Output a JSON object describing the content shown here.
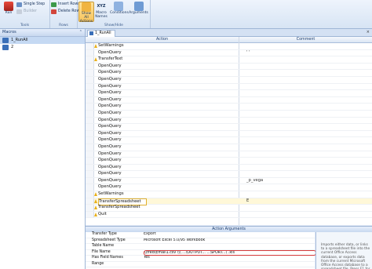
{
  "ribbon": {
    "tools": {
      "run": "Run",
      "single_step": "Single Step",
      "builder": "Builder",
      "label": "Tools"
    },
    "rows": {
      "insert": "Insert Rows",
      "delete": "Delete Rows",
      "label": "Rows"
    },
    "show_hide": {
      "show_all": "Show All Actions",
      "macro_names": "Macro Names",
      "conditions": "Conditions",
      "arguments": "Arguments",
      "xyz": "XYZ",
      "label": "Show/Hide"
    }
  },
  "nav": {
    "title": "Macros",
    "items": [
      {
        "label": "1_RunAll",
        "selected": true
      },
      {
        "label": "2",
        "selected": false
      }
    ]
  },
  "tab": {
    "label": "1_RunAll"
  },
  "grid": {
    "headers": {
      "action": "Action",
      "comment": "Comment"
    },
    "rows": [
      {
        "action": "SetWarnings",
        "comment": "",
        "warn": true
      },
      {
        "action": "OpenQuery",
        "comment": "' '",
        "warn": false
      },
      {
        "action": "TransferText",
        "comment": "",
        "warn": true
      },
      {
        "action": "OpenQuery",
        "comment": "",
        "warn": false
      },
      {
        "action": "OpenQuery",
        "comment": "",
        "warn": false
      },
      {
        "action": "OpenQuery",
        "comment": "",
        "warn": false
      },
      {
        "action": "OpenQuery",
        "comment": "",
        "warn": false
      },
      {
        "action": "OpenQuery",
        "comment": "",
        "warn": false
      },
      {
        "action": "OpenQuery",
        "comment": "",
        "warn": false
      },
      {
        "action": "OpenQuery",
        "comment": "",
        "warn": false
      },
      {
        "action": "OpenQuery",
        "comment": "",
        "warn": false
      },
      {
        "action": "OpenQuery",
        "comment": "",
        "warn": false
      },
      {
        "action": "OpenQuery",
        "comment": "",
        "warn": false
      },
      {
        "action": "OpenQuery",
        "comment": "",
        "warn": false
      },
      {
        "action": "OpenQuery",
        "comment": "",
        "warn": false
      },
      {
        "action": "OpenQuery",
        "comment": "",
        "warn": false
      },
      {
        "action": "OpenQuery",
        "comment": "",
        "warn": false
      },
      {
        "action": "OpenQuery",
        "comment": "",
        "warn": false
      },
      {
        "action": "OpenQuery",
        "comment": "",
        "warn": false
      },
      {
        "action": "OpenQuery",
        "comment": "",
        "warn": false
      },
      {
        "action": "OpenQuery",
        "comment": "_p_vega",
        "warn": false
      },
      {
        "action": "OpenQuery",
        "comment": "",
        "warn": false
      },
      {
        "action": "SetWarnings",
        "comment": "",
        "warn": true
      },
      {
        "action": "TransferSpreadsheet",
        "comment": "E",
        "warn": true,
        "current": true
      },
      {
        "action": "TransferSpreadsheet",
        "comment": "",
        "warn": true
      },
      {
        "action": "Quit",
        "comment": "",
        "warn": true
      }
    ]
  },
  "args_title": "Action Arguments",
  "arguments": [
    {
      "key": "Transfer Type",
      "value": "Export"
    },
    {
      "key": "Spreadsheet Type",
      "value": "Microsoft Excel 5.0/95 Workbook"
    },
    {
      "key": "Table Name",
      "value": ""
    },
    {
      "key": "File Name",
      "value": "\\\\fred\\Email1.csv \\\\\\   ...\\OUTPUT...  ...SPORT...\\ .xls",
      "focus": true
    },
    {
      "key": "Has Field Names",
      "value": "Yes"
    },
    {
      "key": "Range",
      "value": ""
    }
  ],
  "help": "Imports either data, or links to a spreadsheet file into the current Office Access database, or exports data from the current Microsoft Office Access database to a spreadsheet file. Press F1 for help on this action.",
  "colors": {
    "accent": "#3a6fb8",
    "warn": "#e9b01b",
    "focus_border": "#d43b3b"
  }
}
